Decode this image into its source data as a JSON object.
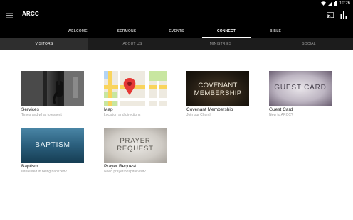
{
  "status": {
    "time": "10:26"
  },
  "app": {
    "title": "ARCC"
  },
  "primary_tabs": [
    {
      "label": "WELCOME",
      "active": false
    },
    {
      "label": "SERMONS",
      "active": false
    },
    {
      "label": "EVENTS",
      "active": false
    },
    {
      "label": "CONNECT",
      "active": true
    },
    {
      "label": "BIBLE",
      "active": false
    }
  ],
  "secondary_tabs": [
    {
      "label": "VISITORS",
      "active": true
    },
    {
      "label": "ABOUT US",
      "active": false
    },
    {
      "label": "MINISTRIES",
      "active": false
    },
    {
      "label": "SOCIAL",
      "active": false
    }
  ],
  "cards": [
    {
      "title": "Services",
      "subtitle": "Times and what to expect",
      "image_text": ""
    },
    {
      "title": "Map",
      "subtitle": "Location and directions",
      "image_text": ""
    },
    {
      "title": "Covenant Membership",
      "subtitle": "Join our Church",
      "image_text_1": "COVENANT",
      "image_text_2": "MEMBERSHIP"
    },
    {
      "title": "Guest Card",
      "subtitle": "New to ARCC?",
      "image_text": "GUEST CARD"
    },
    {
      "title": "Baptism",
      "subtitle": "Interested in being baptized?",
      "image_text": "BAPTISM"
    },
    {
      "title": "Prayer Request",
      "subtitle": "Need prayer/hospital visit?",
      "image_text_1": "PRAYER",
      "image_text_2": "REQUEST"
    }
  ],
  "icons": {
    "menu": "hamburger-menu-icon",
    "cast": "cast-icon",
    "chart": "bar-chart-icon",
    "wifi": "wifi-icon",
    "signal": "signal-icon",
    "battery": "battery-icon",
    "map_pin": "map-pin-icon"
  },
  "colors": {
    "toolbar": "#000000",
    "subtabs": "#1c1c1c",
    "map_pin": "#e53935"
  }
}
